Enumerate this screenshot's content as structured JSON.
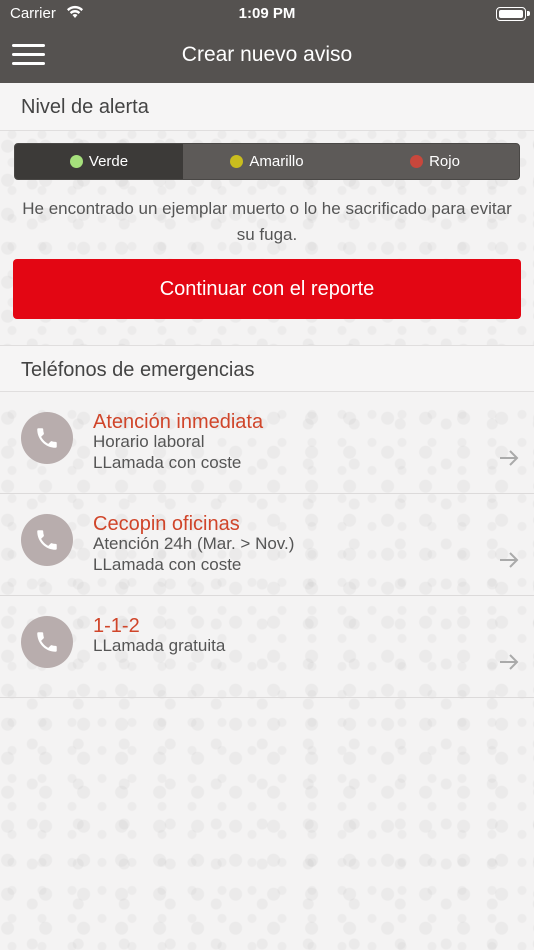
{
  "status_bar": {
    "carrier": "Carrier",
    "time": "1:09 PM"
  },
  "nav": {
    "title": "Crear nuevo aviso",
    "menu_icon": "hamburger-menu-icon"
  },
  "alert_section": {
    "header": "Nivel de alerta",
    "levels": [
      {
        "label": "Verde",
        "color": "#a6e07c",
        "selected": true
      },
      {
        "label": "Amarillo",
        "color": "#c9bd1e",
        "selected": false
      },
      {
        "label": "Rojo",
        "color": "#c8473c",
        "selected": false
      }
    ],
    "description": "He encontrado un ejemplar muerto o lo he sacrificado para evitar su fuga.",
    "continue_label": "Continuar con el reporte"
  },
  "phones_section": {
    "header": "Teléfonos de emergencias",
    "items": [
      {
        "name": "Atención inmediata",
        "line1": "Horario laboral",
        "line2": "LLamada con coste"
      },
      {
        "name": "Cecopin oficinas",
        "line1": "Atención 24h (Mar. > Nov.)",
        "line2": "LLamada con coste"
      },
      {
        "name": "1-1-2",
        "line1": "LLamada gratuita"
      }
    ]
  },
  "colors": {
    "bar": "#555250",
    "accent_red": "#e30613",
    "phone_name": "#d0452a",
    "phone_avatar": "#b8adad"
  }
}
